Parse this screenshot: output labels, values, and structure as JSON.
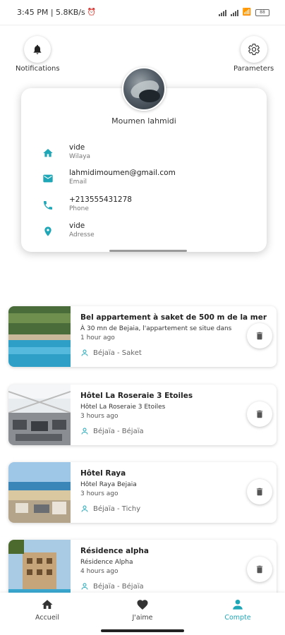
{
  "status_bar": {
    "time_network": "3:45 PM | 5.8KB/s",
    "battery": "88"
  },
  "top_actions": {
    "notifications_label": "Notifications",
    "parameters_label": "Parameters"
  },
  "profile": {
    "name": "Moumen lahmidi",
    "fields": [
      {
        "icon": "home-icon",
        "value": "vide",
        "label": "Wilaya"
      },
      {
        "icon": "email-icon",
        "value": "lahmidimoumen@gmail.com",
        "label": "Email"
      },
      {
        "icon": "phone-icon",
        "value": "+213555431278",
        "label": "Phone"
      },
      {
        "icon": "location-pin-icon",
        "value": "vide",
        "label": "Adresse"
      }
    ]
  },
  "listings": [
    {
      "title": "Bel appartement à saket de 500 m de la mer",
      "description": "À 30 mn de Bejaia, l'appartement se situe dans",
      "time": "1 hour ago",
      "location": "Béjaïa - Saket"
    },
    {
      "title": "Hôtel La Roseraie 3 Etoiles",
      "description": "Hôtel La Roseraie 3 Etoiles",
      "time": "3 hours ago",
      "location": "Béjaïa - Béjaïa"
    },
    {
      "title": "Hôtel Raya",
      "description": "Hôtel Raya Bejaia",
      "time": "3 hours ago",
      "location": "Béjaïa - Tichy"
    },
    {
      "title": "Résidence alpha",
      "description": "Résidence Alpha",
      "time": "4 hours ago",
      "location": "Béjaïa - Béjaïa"
    }
  ],
  "bottom_nav": {
    "items": [
      {
        "label": "Accueil",
        "icon": "home-icon"
      },
      {
        "label": "J'aime",
        "icon": "heart-icon"
      },
      {
        "label": "Compte",
        "icon": "account-icon",
        "active": true
      }
    ]
  },
  "colors": {
    "accent": "#1fa7b8",
    "icon_dark": "#333333"
  }
}
